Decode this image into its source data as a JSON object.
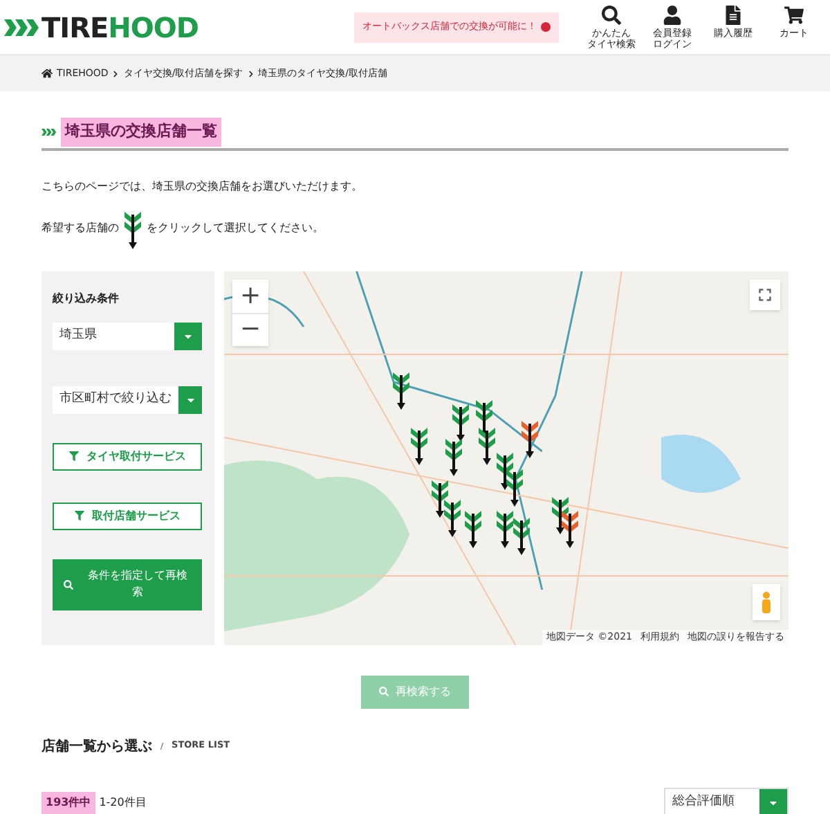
{
  "header": {
    "logo": {
      "part1": "TIRE",
      "part2": "HOOD"
    },
    "promo": "オートバックス店舗での交換が可能に！",
    "nav": [
      {
        "kind": "search",
        "lines": [
          "かんたん",
          "タイヤ検索"
        ]
      },
      {
        "kind": "user",
        "lines": [
          "会員登録",
          "ログイン"
        ]
      },
      {
        "kind": "document",
        "lines": [
          "購入履歴"
        ]
      },
      {
        "kind": "cart",
        "lines": [
          "カート"
        ]
      }
    ]
  },
  "breadcrumb": [
    "TIREHOOD",
    "タイヤ交換/取付店舗を探す",
    "埼玉県のタイヤ交換/取付店舗"
  ],
  "page_title": "埼玉県の交換店舗一覧",
  "intro": {
    "line1": "こちらのページでは、埼玉県の交換店舗をお選びいただけます。",
    "line2_before": "希望する店舗の",
    "line2_after": "をクリックして選択してください。"
  },
  "sidebar": {
    "heading": "絞り込み条件",
    "selects": [
      {
        "value": "埼玉県"
      },
      {
        "value": "市区町村で絞り込む"
      }
    ],
    "filters": [
      "タイヤ取付サービス",
      "取付店舗サービス"
    ],
    "search_button": "条件を指定して再検索"
  },
  "map": {
    "zoom_in": "+",
    "zoom_out": "−",
    "attribution": [
      "地図データ ©2021",
      "利用規約",
      "地図の誤りを報告する"
    ],
    "pins": [
      {
        "color": "#1e9e4a"
      },
      {
        "color": "#1e9e4a"
      },
      {
        "color": "#1e9e4a"
      },
      {
        "color": "#1e9e4a"
      },
      {
        "color": "#1e9e4a"
      },
      {
        "color": "#1e9e4a"
      },
      {
        "color": "#e8602c"
      },
      {
        "color": "#1e9e4a"
      },
      {
        "color": "#1e9e4a"
      },
      {
        "color": "#1e9e4a"
      },
      {
        "color": "#1e9e4a"
      },
      {
        "color": "#1e9e4a"
      },
      {
        "color": "#1e9e4a"
      },
      {
        "color": "#1e9e4a"
      },
      {
        "color": "#1e9e4a"
      },
      {
        "color": "#e8602c"
      }
    ]
  },
  "research_button": {
    "label": "再検索する",
    "disabled": true
  },
  "store_list": {
    "title": "店舗一覧から選ぶ",
    "separator": "/",
    "subtitle": "STORE LIST",
    "count": "193件中",
    "range": "1-20件目",
    "sort": "総合評価順"
  }
}
